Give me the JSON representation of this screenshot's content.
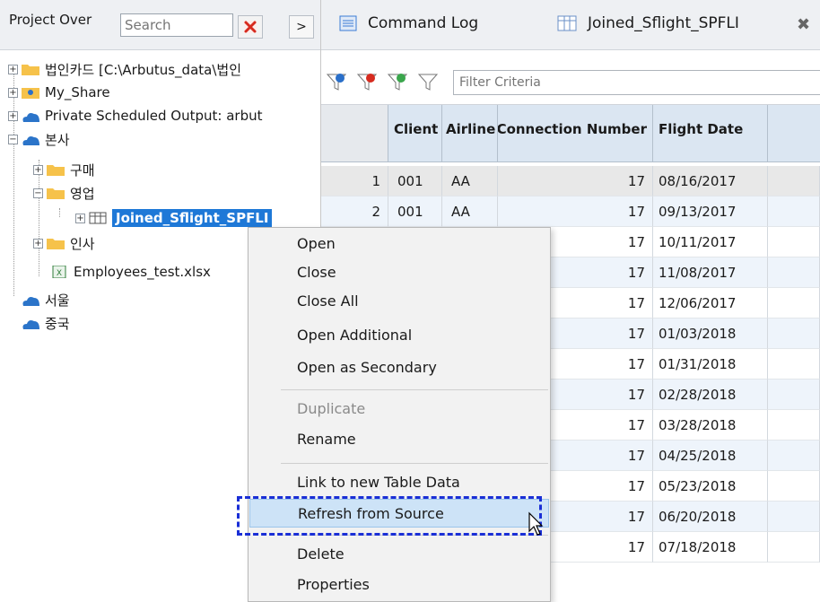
{
  "project_panel": {
    "title": "Project Over",
    "search_placeholder": "Search",
    "tree": [
      {
        "label": "법인카드 [C:\\Arbutus_data\\법인",
        "icon": "folder-icon"
      },
      {
        "label": "My_Share",
        "icon": "user-folder-icon"
      },
      {
        "label": "Private Scheduled Output:  arbut",
        "icon": "cloud-folder-icon"
      },
      {
        "label": "본사",
        "icon": "cloud-folder-icon"
      },
      {
        "label": "구매",
        "icon": "folder-icon"
      },
      {
        "label": "영업",
        "icon": "folder-icon"
      },
      {
        "label": "Joined_Sflight_SPFLI",
        "icon": "table-icon"
      },
      {
        "label": "인사",
        "icon": "folder-icon"
      },
      {
        "label": "Employees_test.xlsx",
        "icon": "excel-file-icon"
      },
      {
        "label": "서울",
        "icon": "cloud-folder-icon"
      },
      {
        "label": "중국",
        "icon": "cloud-folder-icon"
      }
    ]
  },
  "tabs": [
    {
      "label": "Command Log",
      "icon": "list-icon"
    },
    {
      "label": "Joined_Sflight_SPFLI",
      "icon": "table-icon"
    }
  ],
  "filter": {
    "placeholder": "Filter Criteria"
  },
  "table": {
    "columns": [
      "Client",
      "Airline",
      "Connection Number",
      "Flight Date"
    ],
    "rows": [
      {
        "n": "1",
        "client": "001",
        "airline": "AA",
        "conn": "17",
        "date": "08/16/2017"
      },
      {
        "n": "2",
        "client": "001",
        "airline": "AA",
        "conn": "17",
        "date": "09/13/2017"
      },
      {
        "n": "",
        "client": "",
        "airline": "",
        "conn": "17",
        "date": "10/11/2017"
      },
      {
        "n": "",
        "client": "",
        "airline": "",
        "conn": "17",
        "date": "11/08/2017"
      },
      {
        "n": "",
        "client": "",
        "airline": "",
        "conn": "17",
        "date": "12/06/2017"
      },
      {
        "n": "",
        "client": "",
        "airline": "",
        "conn": "17",
        "date": "01/03/2018"
      },
      {
        "n": "",
        "client": "",
        "airline": "",
        "conn": "17",
        "date": "01/31/2018"
      },
      {
        "n": "",
        "client": "",
        "airline": "",
        "conn": "17",
        "date": "02/28/2018"
      },
      {
        "n": "",
        "client": "",
        "airline": "",
        "conn": "17",
        "date": "03/28/2018"
      },
      {
        "n": "",
        "client": "",
        "airline": "",
        "conn": "17",
        "date": "04/25/2018"
      },
      {
        "n": "",
        "client": "",
        "airline": "",
        "conn": "17",
        "date": "05/23/2018"
      },
      {
        "n": "",
        "client": "",
        "airline": "",
        "conn": "17",
        "date": "06/20/2018"
      },
      {
        "n": "",
        "client": "",
        "airline": "",
        "conn": "17",
        "date": "07/18/2018"
      }
    ]
  },
  "context_menu": {
    "items": [
      {
        "label": "Open",
        "disabled": false
      },
      {
        "label": "Close",
        "disabled": false
      },
      {
        "label": "Close All",
        "disabled": false
      },
      {
        "label": "Open Additional",
        "disabled": false
      },
      {
        "label": "Open as Secondary",
        "disabled": false
      },
      {
        "label": "Duplicate",
        "disabled": true
      },
      {
        "label": "Rename",
        "disabled": false
      },
      {
        "label": "Link to new Table Data",
        "disabled": false
      },
      {
        "label": "Refresh from Source",
        "disabled": false,
        "highlighted": true
      },
      {
        "label": "Delete",
        "disabled": false
      },
      {
        "label": "Properties",
        "disabled": false
      }
    ]
  },
  "colors": {
    "selection": "#1e78d7",
    "menu_highlight": "#cde3f7",
    "annotation": "#1a2fd6",
    "header_bg": "#dbe6f2"
  }
}
